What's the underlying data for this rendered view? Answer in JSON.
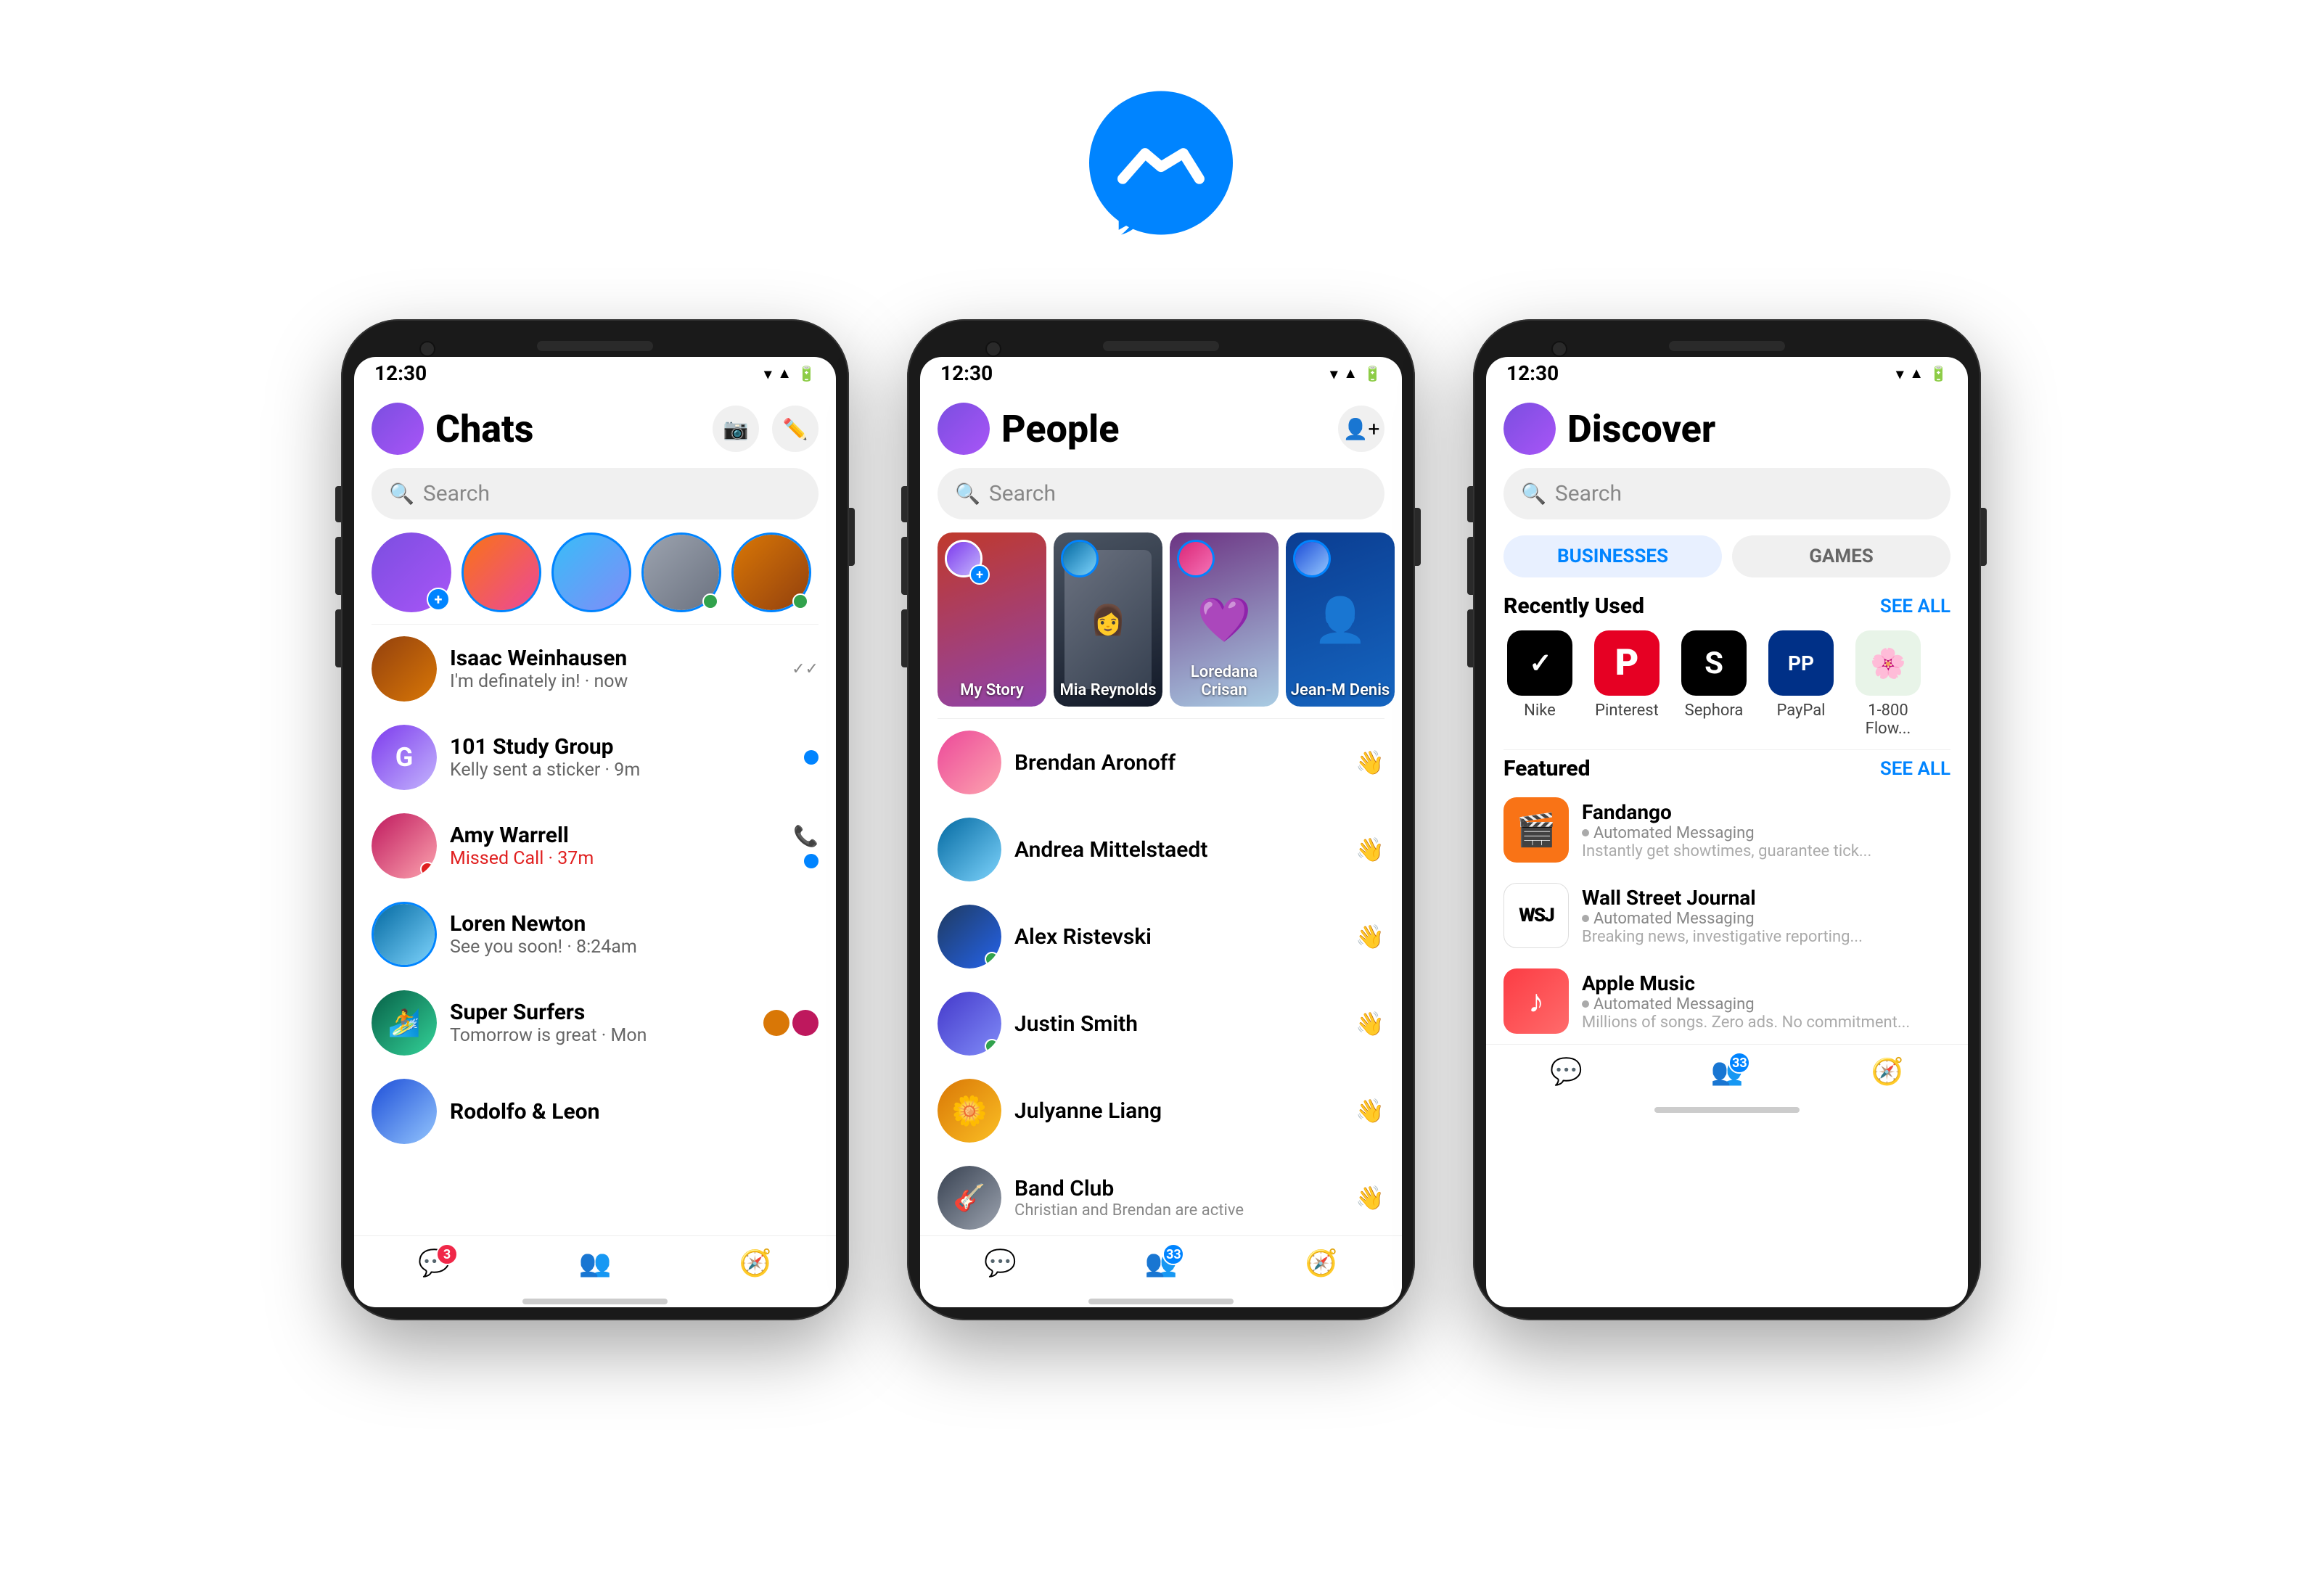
{
  "logo": {
    "alt": "Messenger Logo"
  },
  "phone1": {
    "status_bar": {
      "time": "12:30"
    },
    "header": {
      "title": "Chats"
    },
    "search": {
      "placeholder": "Search"
    },
    "chats": [
      {
        "name": "Isaac Weinhausen",
        "preview": "I'm definately in! · now",
        "time": "",
        "status": "check"
      },
      {
        "name": "101 Study Group",
        "preview": "Kelly sent a sticker · 9m",
        "time": "",
        "status": "blue-dot"
      },
      {
        "name": "Amy Warrell",
        "preview": "Missed Call · 37m",
        "time": "",
        "status": "blue-dot",
        "missed": true
      },
      {
        "name": "Loren Newton",
        "preview": "See you soon! · 8:24am",
        "time": "",
        "status": ""
      },
      {
        "name": "Super Surfers",
        "preview": "Tomorrow is great · Mon",
        "time": "",
        "status": ""
      },
      {
        "name": "Rodolfo & Leon",
        "preview": "",
        "time": "",
        "status": ""
      }
    ],
    "bottom_nav": {
      "chat_badge": "3",
      "people_label": "people",
      "discover_label": "discover"
    }
  },
  "phone2": {
    "status_bar": {
      "time": "12:30"
    },
    "header": {
      "title": "People"
    },
    "search": {
      "placeholder": "Search"
    },
    "stories": [
      {
        "label": "My Story",
        "bg": "my"
      },
      {
        "label": "Mia Reynolds",
        "bg": "red"
      },
      {
        "label": "Loredana Crisan",
        "bg": "purple"
      },
      {
        "label": "Jean-M Denis",
        "bg": "blue"
      }
    ],
    "people": [
      {
        "name": "Brendan Aronoff",
        "online": false
      },
      {
        "name": "Andrea Mittelstaedt",
        "online": false
      },
      {
        "name": "Alex Ristevski",
        "online": true
      },
      {
        "name": "Justin Smith",
        "online": true
      },
      {
        "name": "Julyanne Liang",
        "online": false
      },
      {
        "name": "Band Club",
        "online": false,
        "preview": "Christian and Brendan are active"
      }
    ],
    "bottom_nav": {
      "people_badge": "33"
    }
  },
  "phone3": {
    "status_bar": {
      "time": "12:30"
    },
    "header": {
      "title": "Discover"
    },
    "search": {
      "placeholder": "Search"
    },
    "tabs": [
      {
        "label": "BUSINESSES",
        "active": true
      },
      {
        "label": "GAMES",
        "active": false
      }
    ],
    "recently_used": {
      "title": "Recently Used",
      "see_all": "SEE ALL",
      "apps": [
        {
          "name": "Nike",
          "color": "#000000",
          "text": "✓",
          "text_color": "#fff"
        },
        {
          "name": "Pinterest",
          "color": "#e60023",
          "text": "P",
          "text_color": "#fff"
        },
        {
          "name": "Sephora",
          "color": "#000000",
          "text": "S",
          "text_color": "#fff"
        },
        {
          "name": "PayPal",
          "color": "#003087",
          "text": "PP",
          "text_color": "#fff"
        },
        {
          "name": "1-800 Flow...",
          "color": "#e8f4e8",
          "text": "🌸",
          "text_color": "#333"
        }
      ]
    },
    "featured": {
      "title": "Featured",
      "see_all": "SEE ALL",
      "items": [
        {
          "name": "Fandango",
          "subtitle": "Automated Messaging",
          "desc": "Instantly get showtimes, guarantee tick...",
          "color": "#f97316",
          "icon": "🎬"
        },
        {
          "name": "Wall Street Journal",
          "subtitle": "Automated Messaging",
          "desc": "Breaking news, investigative reporting...",
          "color": "#fff",
          "icon": "WSJ",
          "border": true
        },
        {
          "name": "Apple Music",
          "subtitle": "Automated Messaging",
          "desc": "Millions of songs. Zero ads. No commitment...",
          "color": "#fc3c44",
          "icon": "♪"
        }
      ]
    },
    "bottom_nav": {
      "people_badge": "33"
    }
  }
}
